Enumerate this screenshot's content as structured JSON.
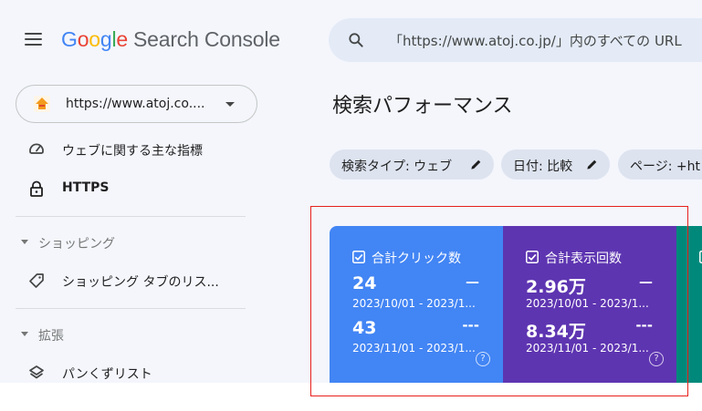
{
  "header": {
    "logo_letters": [
      "G",
      "o",
      "o",
      "g",
      "l",
      "e"
    ],
    "product": "Search Console",
    "search_placeholder": "「https://www.atoj.co.jp/」内のすべての URL"
  },
  "sidebar": {
    "property": "https://www.atoj.co....",
    "items_top": [
      {
        "label": "ウェブに関する主な指標",
        "icon": "gauge-icon"
      },
      {
        "label": "HTTPS",
        "icon": "lock-icon"
      }
    ],
    "sections": [
      {
        "label": "ショッピング",
        "items": [
          {
            "label": "ショッピング タブのリス...",
            "icon": "tag-icon"
          }
        ]
      },
      {
        "label": "拡張",
        "items": [
          {
            "label": "パンくずリスト",
            "icon": "layers-icon"
          }
        ]
      }
    ]
  },
  "main": {
    "title": "検索パフォーマンス",
    "chips": [
      {
        "label": "検索タイプ: ウェブ"
      },
      {
        "label": "日付: 比較"
      },
      {
        "label": "ページ: +ht"
      }
    ],
    "cards": [
      {
        "label": "合計クリック数",
        "color": "#4285f4",
        "value1": "24",
        "delta1": "—",
        "date1": "2023/10/01 - 2023/1...",
        "value2": "43",
        "delta2": "---",
        "date2": "2023/11/01 - 2023/1..."
      },
      {
        "label": "合計表示回数",
        "color": "#5e35b1",
        "value1": "2.96万",
        "delta1": "—",
        "date1": "2023/10/01 - 2023/1...",
        "value2": "8.34万",
        "delta2": "---",
        "date2": "2023/11/01 - 2023/1..."
      }
    ],
    "third_card_color": "#00897b",
    "help_glyph": "?"
  },
  "colors": {
    "highlight": "#e8201c",
    "background": "#f4f6fc"
  }
}
